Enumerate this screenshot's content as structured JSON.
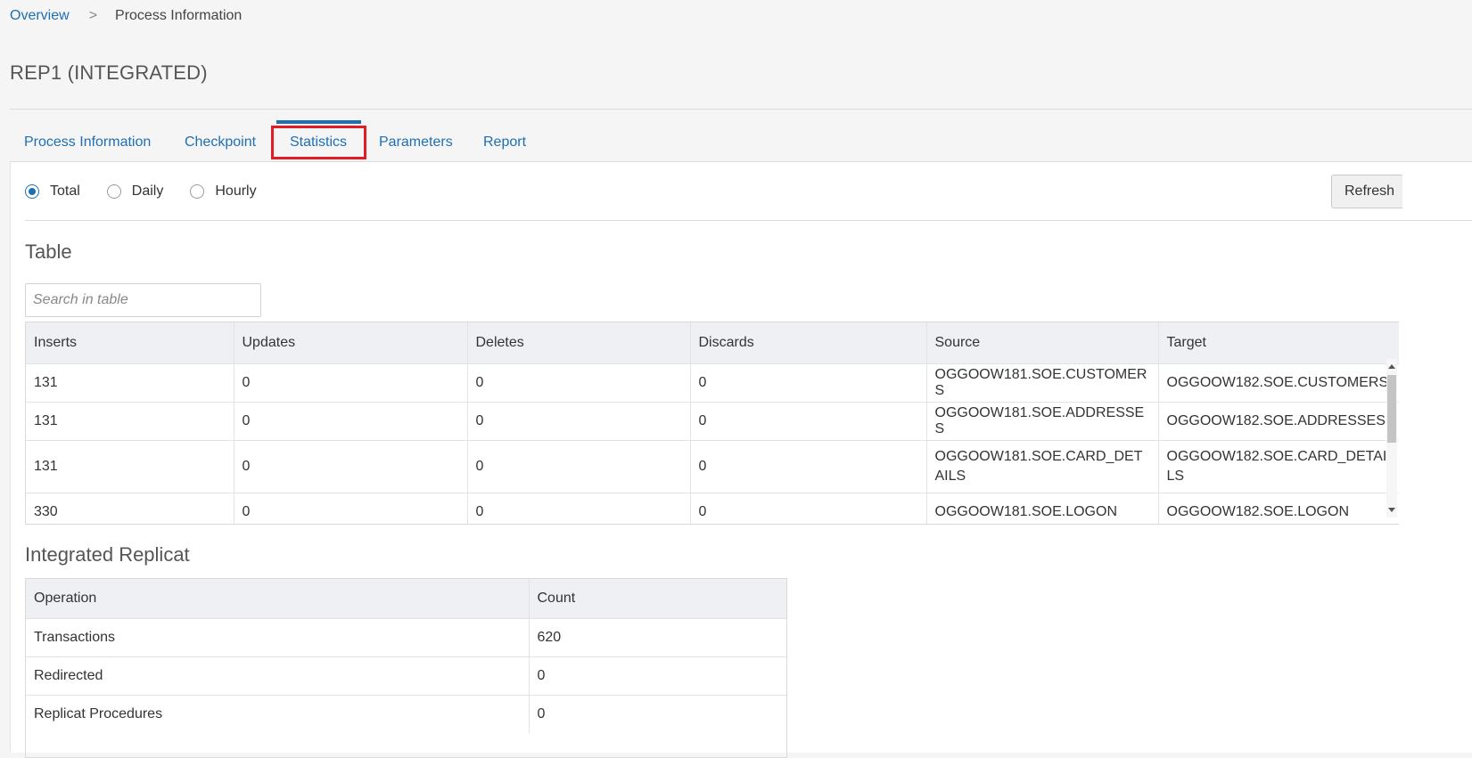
{
  "breadcrumb": {
    "overview": "Overview",
    "separator": ">",
    "current": "Process Information"
  },
  "page": {
    "title": "REP1 (INTEGRATED)"
  },
  "tabs": [
    {
      "label": "Process Information",
      "active": false
    },
    {
      "label": "Checkpoint",
      "active": false
    },
    {
      "label": "Statistics",
      "active": true
    },
    {
      "label": "Parameters",
      "active": false
    },
    {
      "label": "Report",
      "active": false
    }
  ],
  "period": {
    "options": [
      "Total",
      "Daily",
      "Hourly"
    ],
    "selected": "Total"
  },
  "refresh_label": "Refresh",
  "table_section": {
    "heading": "Table",
    "search_placeholder": "Search in table",
    "columns": [
      "Inserts",
      "Updates",
      "Deletes",
      "Discards",
      "Source",
      "Target"
    ],
    "rows": [
      [
        "131",
        "0",
        "0",
        "0",
        "OGGOOW181.SOE.CUSTOMERS",
        "OGGOOW182.SOE.CUSTOMERS"
      ],
      [
        "131",
        "0",
        "0",
        "0",
        "OGGOOW181.SOE.ADDRESSES",
        "OGGOOW182.SOE.ADDRESSES"
      ],
      [
        "131",
        "0",
        "0",
        "0",
        "OGGOOW181.SOE.CARD_DETAILS",
        "OGGOOW182.SOE.CARD_DETAILS"
      ],
      [
        "330",
        "0",
        "0",
        "0",
        "OGGOOW181.SOE.LOGON",
        "OGGOOW182.SOE.LOGON"
      ]
    ]
  },
  "replicat_section": {
    "heading": "Integrated Replicat",
    "columns": [
      "Operation",
      "Count"
    ],
    "rows": [
      [
        "Transactions",
        "620"
      ],
      [
        "Redirected",
        "0"
      ],
      [
        "Replicat Procedures",
        "0"
      ]
    ]
  },
  "colors": {
    "link": "#1f6fb3",
    "highlight_box": "#e31c23",
    "header_bg": "#eef0f4"
  }
}
